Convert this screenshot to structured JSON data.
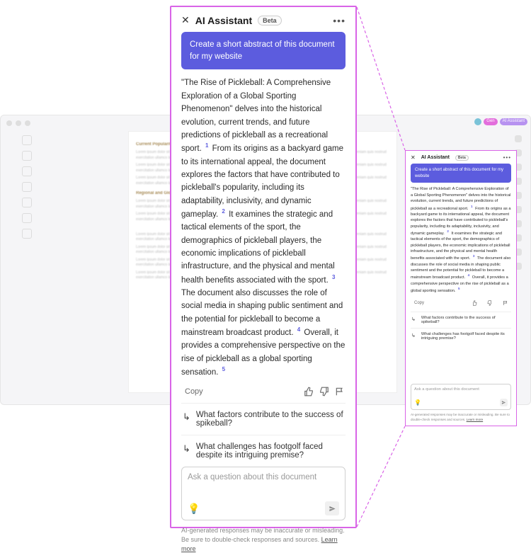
{
  "header": {
    "title": "AI Assistant",
    "badge": "Beta"
  },
  "prompt": "Create a short abstract of this document for my website",
  "answer": {
    "p1": "\"The Rise of Pickleball: A Comprehensive Exploration of a Global Sporting Phenomenon\" delves into the historical evolution, current trends, and future predictions of pickleball as a recreational sport.",
    "c1": "1",
    "p2": "From its origins as a backyard game to its international appeal, the document explores the factors that have contributed to pickleball's popularity, including its adaptability, inclusivity, and dynamic gameplay.",
    "c2": "2",
    "p3": "It examines the strategic and tactical elements of the sport, the demographics of pickleball players, the economic implications of pickleball infrastructure, and the physical and mental health benefits associated with the sport.",
    "c3": "3",
    "p4": "The document also discusses the role of social media in shaping public sentiment and the potential for pickleball to become a mainstream broadcast product.",
    "c4": "4",
    "p5": "Overall, it provides a comprehensive perspective on the rise of pickleball as a global sporting sensation.",
    "c5": "5"
  },
  "actions": {
    "copy": "Copy"
  },
  "suggestions": [
    "What factors contribute to the success of spikeball?",
    "What challenges has footgolf faced despite its intriguing premise?"
  ],
  "input": {
    "placeholder": "Ask a question about this document"
  },
  "disclaimer": {
    "text": "AI-generated responses may be inaccurate or misleading. Be sure to double-check responses and sources. ",
    "link": "Learn more"
  },
  "bg": {
    "h1": "Current Popularity",
    "h2": "Regional and Global",
    "lorem": "Lorem ipsum dolor sit amet consectetur adipiscing elit sed do eiusmod tempor incididunt ut labore et dolore magna aliqua ut enim ad minim veniam quis nostrud exercitation ullamco laboris."
  }
}
